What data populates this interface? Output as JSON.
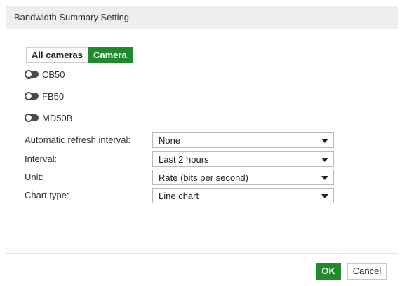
{
  "dialog": {
    "title": "Bandwidth Summary Setting"
  },
  "tabs": [
    {
      "label": "All cameras",
      "active": false
    },
    {
      "label": "Camera",
      "active": true
    }
  ],
  "cameras": [
    {
      "label": "CB50",
      "enabled": false
    },
    {
      "label": "FB50",
      "enabled": false
    },
    {
      "label": "MD50B",
      "enabled": false
    }
  ],
  "form": {
    "refresh": {
      "label": "Automatic refresh interval:",
      "value": "None"
    },
    "interval": {
      "label": "Interval:",
      "value": "Last 2 hours"
    },
    "unit": {
      "label": "Unit:",
      "value": "Rate (bits per second)"
    },
    "chart_type": {
      "label": "Chart type:",
      "value": "Line chart"
    }
  },
  "buttons": {
    "ok": "OK",
    "cancel": "Cancel"
  },
  "colors": {
    "accent": "#1e8a2d",
    "header_bg": "#eeeeee"
  }
}
